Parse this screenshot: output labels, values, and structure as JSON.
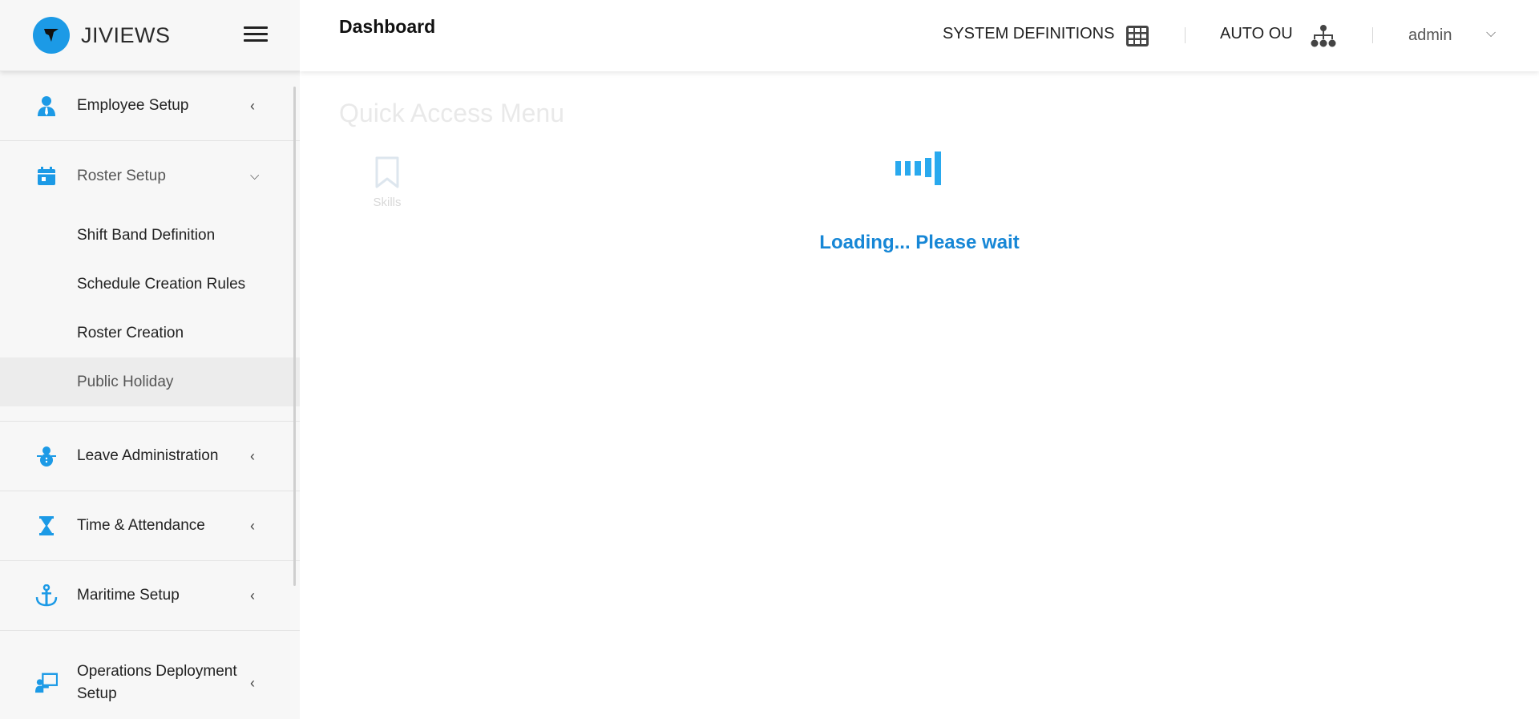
{
  "brand": {
    "name": "JIVIEWS",
    "color": "#1c9ae6"
  },
  "sidebar": {
    "items": [
      {
        "label": "Employee Setup",
        "icon": "user-tie-icon",
        "expanded": false
      },
      {
        "label": "Roster Setup",
        "icon": "calendar-icon",
        "expanded": true,
        "children": [
          {
            "label": "Shift Band Definition"
          },
          {
            "label": "Schedule Creation Rules"
          },
          {
            "label": "Roster Creation"
          },
          {
            "label": "Public Holiday",
            "active": true
          }
        ]
      },
      {
        "label": "Leave Administration",
        "icon": "snowman-icon",
        "expanded": false
      },
      {
        "label": "Time & Attendance",
        "icon": "hourglass-icon",
        "expanded": false
      },
      {
        "label": "Maritime Setup",
        "icon": "anchor-icon",
        "expanded": false
      },
      {
        "label": "Operations Deployment Setup",
        "icon": "presenter-icon",
        "expanded": false
      }
    ]
  },
  "header": {
    "title": "Dashboard",
    "system_definitions": "SYSTEM DEFINITIONS",
    "auto_ou": "AUTO OU",
    "user": "admin"
  },
  "main": {
    "quick_access_title": "Quick Access Menu",
    "tiles": [
      {
        "label": "Skills",
        "icon": "bookmark-icon"
      }
    ],
    "loading_text": "Loading... Please wait"
  },
  "colors": {
    "accent": "#1c9ae6",
    "loading_text": "#1787d6"
  }
}
